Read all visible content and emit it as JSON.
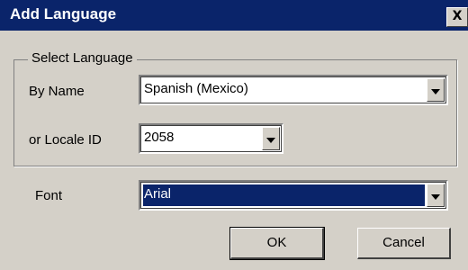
{
  "dialog": {
    "title": "Add Language",
    "close_glyph": "X"
  },
  "group": {
    "legend": "Select Language",
    "by_name_label": "By Name",
    "by_name_value": "Spanish (Mexico)",
    "locale_label": "or Locale ID",
    "locale_value": "2058"
  },
  "font": {
    "label": "Font",
    "value": "Arial"
  },
  "buttons": {
    "ok": "OK",
    "cancel": "Cancel"
  },
  "colors": {
    "title_bar": "#0a246a",
    "dialog_bg": "#d4d0c8",
    "selection": "#0a246a"
  }
}
